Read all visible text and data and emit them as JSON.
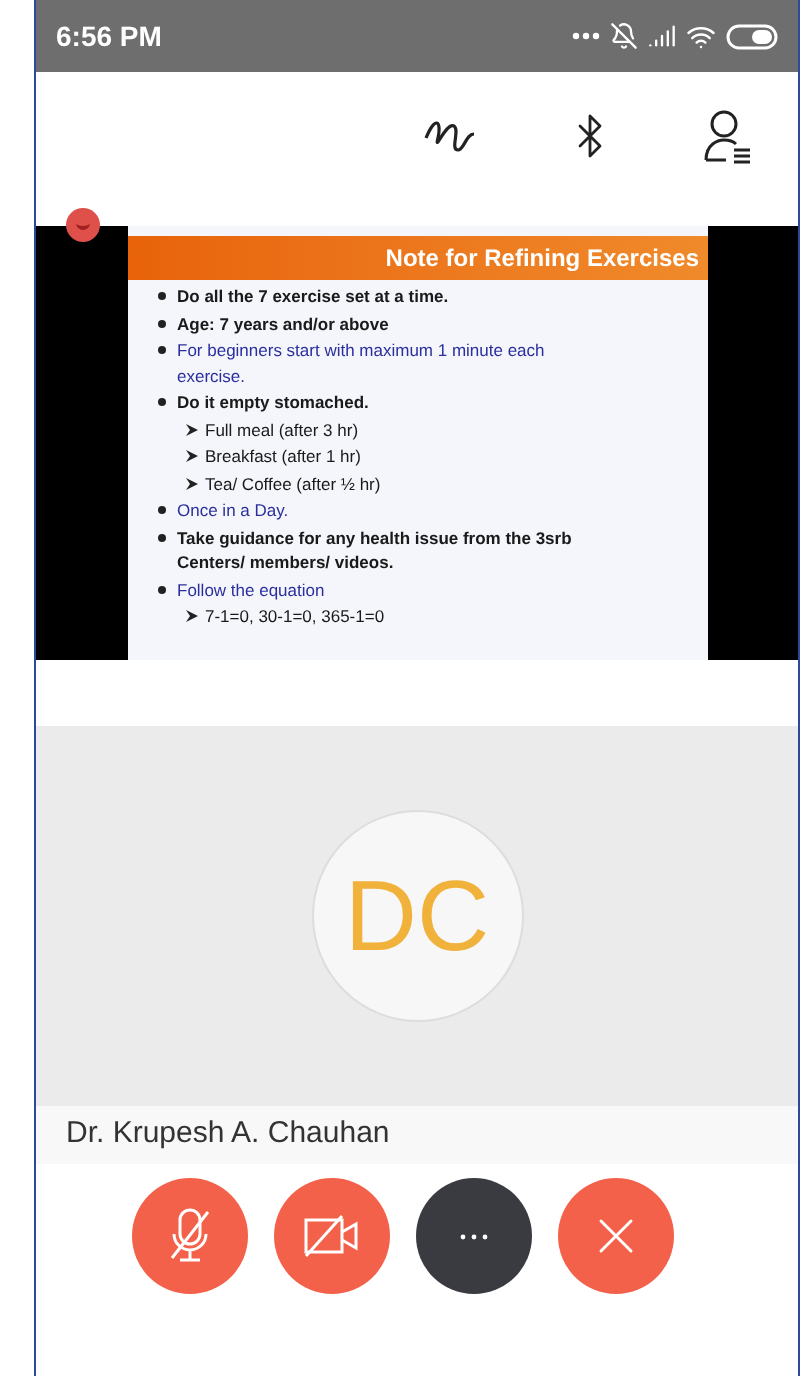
{
  "status_bar": {
    "time": "6:56 PM"
  },
  "slide": {
    "title": "Note for Refining Exercises",
    "items": [
      {
        "kind": "bullet",
        "text": "Do all the 7 exercise set at a time.",
        "color": "#1a1a1a",
        "bold": true
      },
      {
        "kind": "bullet",
        "text": "Age: 7 years and/or above",
        "color": "#1a1a1a",
        "bold": true
      },
      {
        "kind": "bullet",
        "text": "For beginners start with maximum 1 minute each exercise.",
        "color": "#2b2f9e",
        "bold": false
      },
      {
        "kind": "bullet",
        "text": "Do it empty stomached.",
        "color": "#1a1a1a",
        "bold": true
      },
      {
        "kind": "sub",
        "text": "Full meal (after 3 hr)",
        "color": "#1a1a1a",
        "bold": false
      },
      {
        "kind": "sub",
        "text": "Breakfast (after 1 hr)",
        "color": "#1a1a1a",
        "bold": false
      },
      {
        "kind": "sub",
        "text": "Tea/ Coffee (after ½ hr)",
        "color": "#1a1a1a",
        "bold": false
      },
      {
        "kind": "bullet",
        "text": "Once in a Day.",
        "color": "#2b2f9e",
        "bold": false
      },
      {
        "kind": "bullet",
        "text": "Take guidance for any health issue from the 3srb Centers/ members/ videos.",
        "color": "#1a1a1a",
        "bold": true
      },
      {
        "kind": "bullet",
        "text": "Follow the equation",
        "color": "#2b2f9e",
        "bold": false
      },
      {
        "kind": "sub",
        "text": "7-1=0, 30-1=0, 365-1=0",
        "color": "#1a1a1a",
        "bold": false
      }
    ]
  },
  "participant": {
    "initials": "DC",
    "name": "Dr. Krupesh A. Chauhan"
  },
  "controls": [
    {
      "kind": "mic",
      "on": false
    },
    {
      "kind": "camera",
      "on": false
    },
    {
      "kind": "more"
    },
    {
      "kind": "end"
    }
  ]
}
